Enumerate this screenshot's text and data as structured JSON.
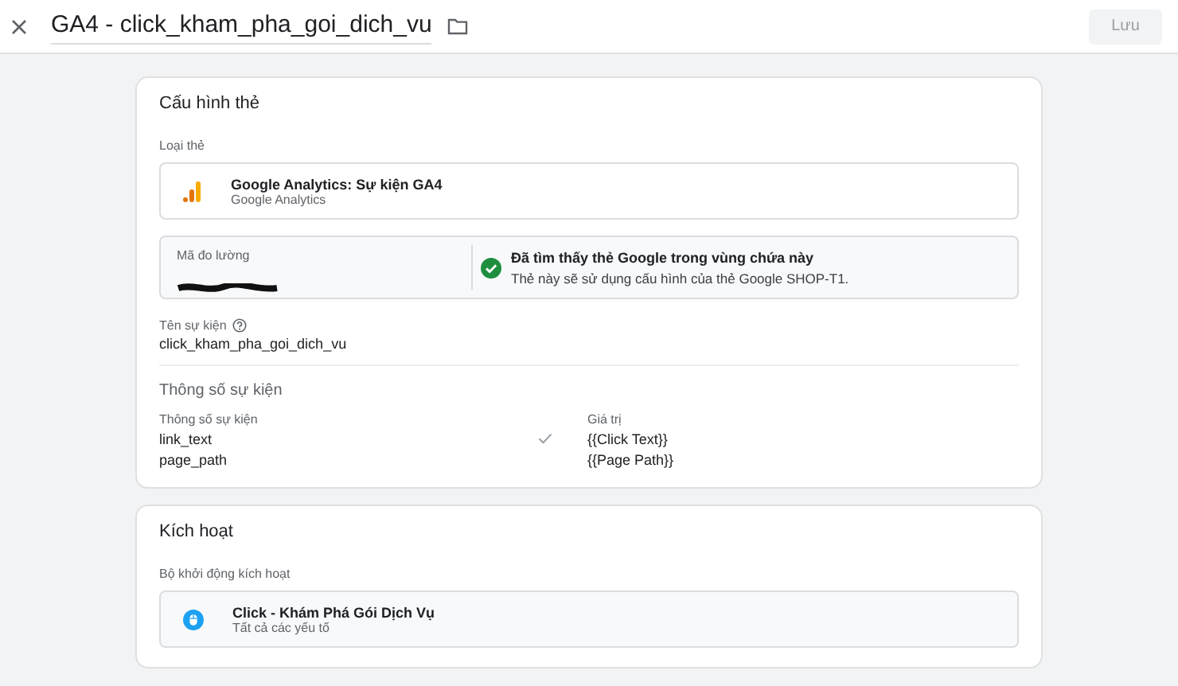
{
  "header": {
    "title": "GA4 - click_kham_pha_goi_dich_vu",
    "save_button": {
      "label": "Lưu",
      "disabled": true
    }
  },
  "tag_config": {
    "title": "Cấu hình thẻ",
    "type_label": "Loại thẻ",
    "tag_type": {
      "name": "Google Analytics: Sự kiện GA4",
      "subtitle": "Google Analytics"
    },
    "measurement": {
      "label": "Mã đo lường",
      "status_title": "Đã tìm thấy thẻ Google trong vùng chứa này",
      "status_text": "Thẻ này sẽ sử dụng cấu hình của thẻ Google SHOP-T1."
    },
    "event_name": {
      "label": "Tên sự kiện",
      "value": "click_kham_pha_goi_dich_vu"
    },
    "params": {
      "title": "Thông số sự kiện",
      "columns": [
        "Thông số sự kiện",
        "Giá trị"
      ],
      "rows": [
        {
          "name": "link_text",
          "value": "{{Click Text}}",
          "checked": true
        },
        {
          "name": "page_path",
          "value": "{{Page Path}}",
          "checked": false
        }
      ]
    }
  },
  "triggering": {
    "title": "Kích hoạt",
    "label": "Bộ khởi động kích hoạt",
    "trigger": {
      "name": "Click - Khám Phá Gói Dịch Vụ",
      "subtitle": "Tất cả các yếu tố"
    }
  }
}
